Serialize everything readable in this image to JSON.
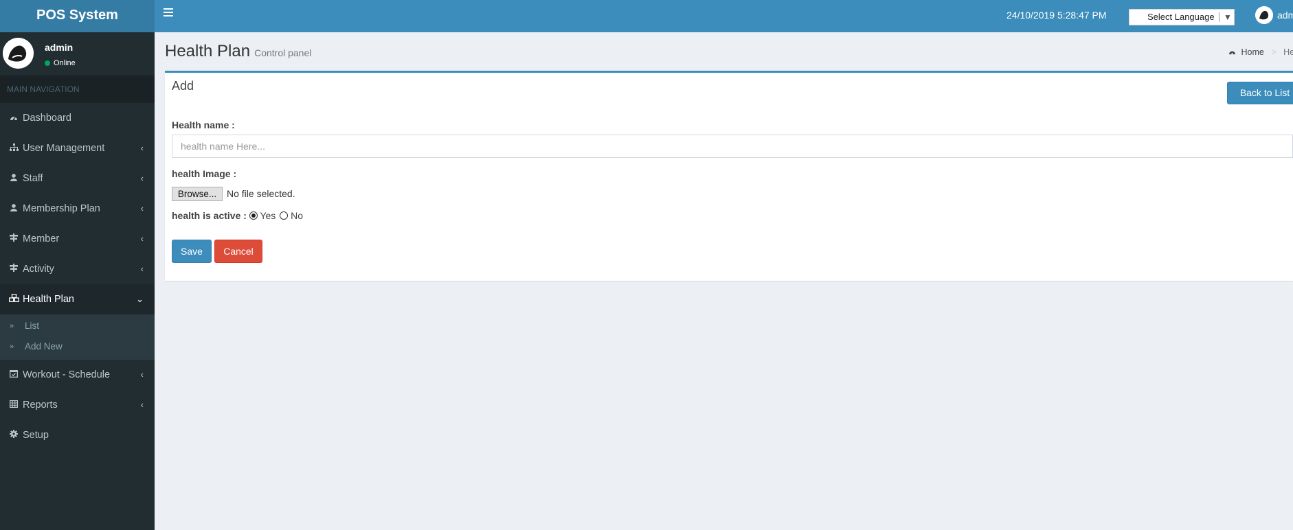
{
  "app": {
    "title": "POS System"
  },
  "header": {
    "datetime": "24/10/2019 5:28:47 PM",
    "language_select": "Select Language",
    "user_name": "admin"
  },
  "sidebar": {
    "user": {
      "name": "admin",
      "status": "Online"
    },
    "nav_header": "MAIN NAVIGATION",
    "items": [
      {
        "label": "Dashboard",
        "icon": "dashboard-icon"
      },
      {
        "label": "User Management",
        "icon": "sitemap-icon"
      },
      {
        "label": "Staff",
        "icon": "user-icon"
      },
      {
        "label": "Membership Plan",
        "icon": "user-icon"
      },
      {
        "label": "Member",
        "icon": "signpost-icon"
      },
      {
        "label": "Activity",
        "icon": "signpost-icon"
      },
      {
        "label": "Health Plan",
        "icon": "cubes-icon"
      },
      {
        "label": "Workout - Schedule",
        "icon": "calendar-check-icon"
      },
      {
        "label": "Reports",
        "icon": "table-icon"
      },
      {
        "label": "Setup",
        "icon": "gear-icon"
      }
    ],
    "health_plan_sub": [
      {
        "label": "List"
      },
      {
        "label": "Add New"
      }
    ]
  },
  "page": {
    "title": "Health Plan",
    "subtitle": "Control panel",
    "breadcrumb": {
      "home": "Home",
      "current": "Health Plan"
    }
  },
  "form": {
    "box_title": "Add",
    "back_button": "Back to List",
    "name_label": "Health name :",
    "name_placeholder": "health name Here...",
    "name_value": "",
    "image_label": "health Image :",
    "browse_button": "Browse...",
    "file_status": "No file selected.",
    "active_label": "health is active :",
    "active_yes": "Yes",
    "active_no": "No",
    "active_selected": "Yes",
    "save_button": "Save",
    "cancel_button": "Cancel"
  },
  "colors": {
    "header": "#3c8dbc",
    "logo": "#357ca5",
    "sidebar": "#222d32",
    "primary": "#3c8dbc",
    "danger": "#dd4b39",
    "online": "#00a65a"
  }
}
